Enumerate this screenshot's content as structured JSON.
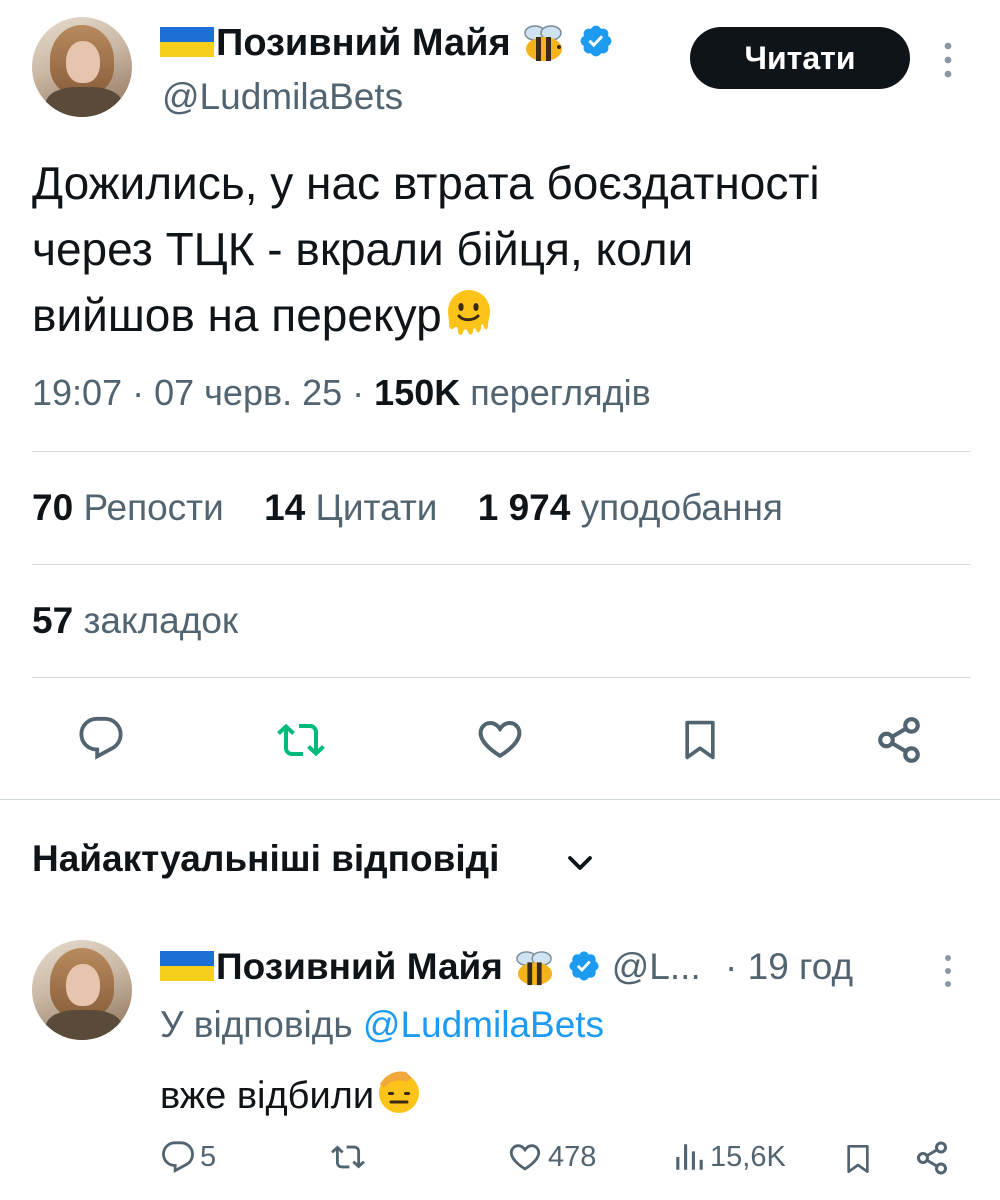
{
  "tweet": {
    "author": {
      "name": "Позивний Майя",
      "handle": "@LudmilaBets",
      "flag_icon": "ukraine-flag-icon",
      "badge_icon": "bee-emoji",
      "verified_icon": "verified-badge-icon",
      "verified_color": "#1d9bf0"
    },
    "follow_label": "Читати",
    "text_line1": "Дожились, у нас втрата боєздатності",
    "text_line2": "через ТЦК - вкрали бійця, коли",
    "text_line3": "вийшов на перекур",
    "text_emoji": "melting-face-emoji",
    "time": "19:07",
    "date": "07 черв. 25",
    "views_count": "150K",
    "views_label": "переглядів",
    "separator": "·",
    "stats": {
      "reposts_count": "70",
      "reposts_label": "Репости",
      "quotes_count": "14",
      "quotes_label": "Цитати",
      "likes_count": "1 974",
      "likes_label": "уподобання",
      "bookmarks_count": "57",
      "bookmarks_label": "закладок"
    },
    "actions": [
      "reply-icon",
      "retweet-icon",
      "like-icon",
      "bookmark-icon",
      "share-icon"
    ],
    "retweet_color": "#00ba7c"
  },
  "replies_section": {
    "title": "Найактуальніші відповіді"
  },
  "reply": {
    "name": "Позивний Майя",
    "handle": "@L...",
    "time": "· 19 год",
    "replying_to_label": "У відповідь",
    "replying_to_handle": "@LudmilaBets",
    "text": "вже відбили",
    "text_emoji": "saluting-face-emoji",
    "reply_count": "5",
    "like_count": "478",
    "views_count": "15,6K"
  },
  "colors": {
    "text": "#0f1419",
    "secondary": "#536471",
    "accent": "#1d9bf0",
    "divider": "#cfd9de"
  }
}
